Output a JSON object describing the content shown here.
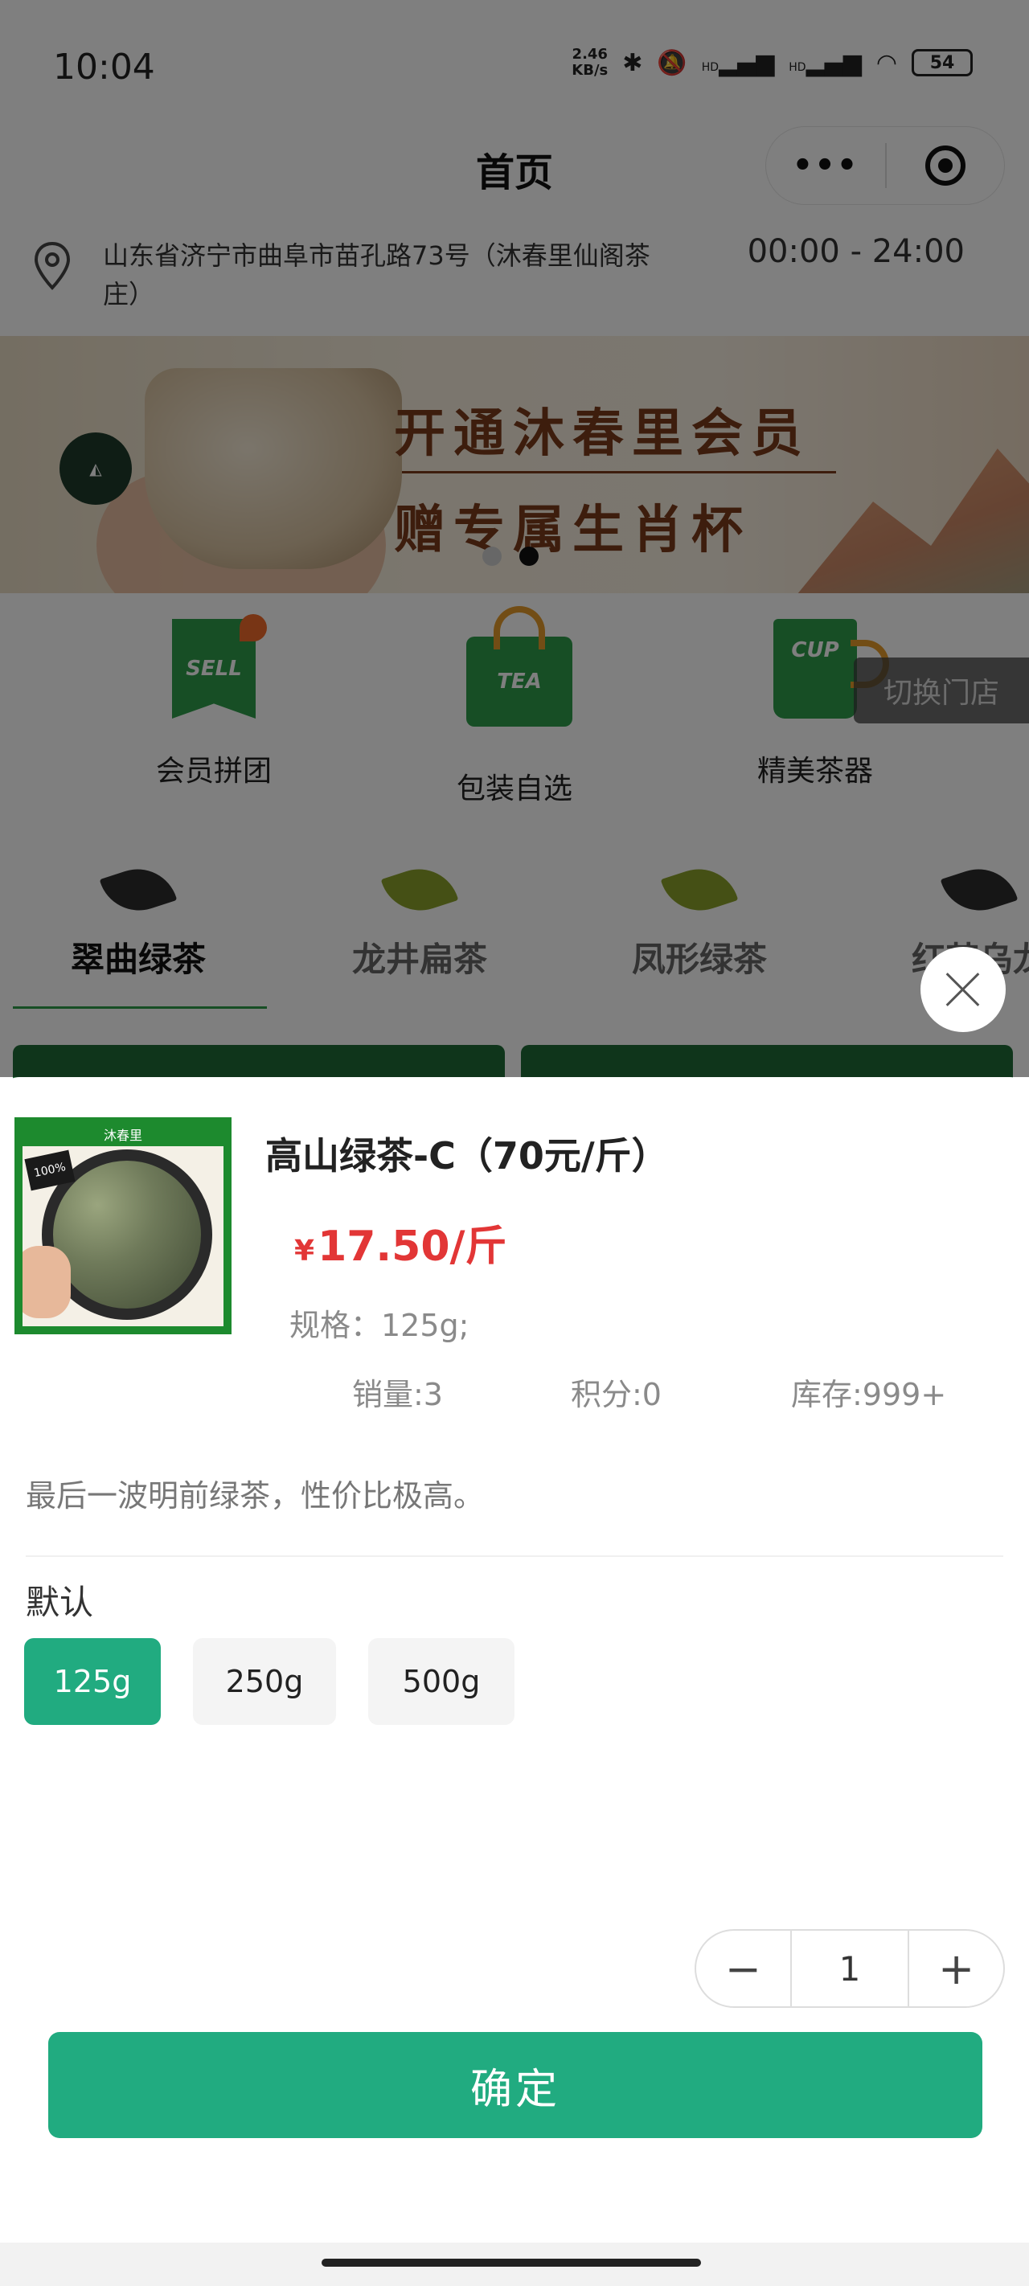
{
  "status_bar": {
    "time": "10:04",
    "net_speed_value": "2.46",
    "net_speed_unit": "KB/s",
    "signal_1": "HD",
    "signal_2": "HD",
    "battery": "54"
  },
  "nav": {
    "title": "首页",
    "more_icon": "more-dots-icon",
    "capsule_icon": "target-icon"
  },
  "store": {
    "address": "山东省济宁市曲阜市苗孔路73号（沐春里仙阁茶庄）",
    "hours": "00:00 - 24:00",
    "switch_label": "切换门店"
  },
  "banner": {
    "line1": "开通沐春里会员",
    "line2": "赠专属生肖杯",
    "slide_count": 2,
    "active_slide": 2
  },
  "quick_entries": [
    {
      "label": "会员拼团",
      "icon": "sell-tag-icon",
      "icon_text": "SELL"
    },
    {
      "label": "包装自选",
      "icon": "tea-bag-icon",
      "icon_text": "TEA"
    },
    {
      "label": "精美茶器",
      "icon": "cup-icon",
      "icon_text": "CUP"
    }
  ],
  "categories": [
    {
      "label": "翠曲绿茶",
      "active": true
    },
    {
      "label": "龙井扁茶",
      "active": false
    },
    {
      "label": "凤形绿茶",
      "active": false
    },
    {
      "label": "红茶乌龙",
      "active": false
    }
  ],
  "product": {
    "title": "高山绿茶-C（70元/斤）",
    "currency": "¥",
    "price": "17.50/斤",
    "spec": "规格：125g;",
    "stats": {
      "sales": "销量:3",
      "points": "积分:0",
      "stock": "库存:999+"
    },
    "description": "最后一波明前绿茶，性价比极高。",
    "thumb_brand": "沐春里"
  },
  "spec_group": {
    "name": "默认",
    "options": [
      {
        "label": "125g",
        "selected": true
      },
      {
        "label": "250g",
        "selected": false
      },
      {
        "label": "500g",
        "selected": false
      }
    ]
  },
  "quantity": {
    "minus": "−",
    "value": "1",
    "plus": "+"
  },
  "actions": {
    "confirm_label": "确定"
  },
  "colors": {
    "accent": "#21ab80",
    "price": "#e23636",
    "overlay": "rgba(0,0,0,0.5)"
  }
}
